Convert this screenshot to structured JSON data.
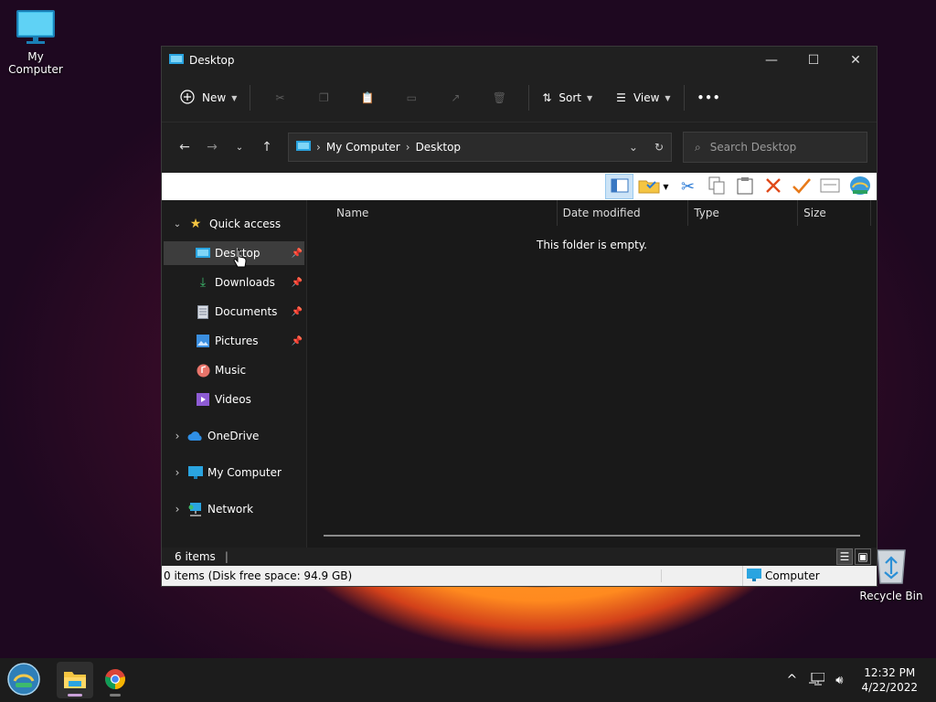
{
  "desktop": {
    "my_computer_label": "My Computer",
    "recycle_bin_label": "Recycle Bin"
  },
  "window": {
    "title": "Desktop",
    "controls": {
      "minimize": "—",
      "maximize": "☐",
      "close": "✕"
    }
  },
  "commandbar": {
    "new_label": "New",
    "sort_label": "Sort",
    "view_label": "View",
    "more_label": "•••"
  },
  "address": {
    "crumbs": [
      "My Computer",
      "Desktop"
    ],
    "search_placeholder": "Search Desktop"
  },
  "nav": {
    "quick_access": "Quick access",
    "items": [
      {
        "label": "Desktop",
        "pinned": true,
        "selected": true
      },
      {
        "label": "Downloads",
        "pinned": true
      },
      {
        "label": "Documents",
        "pinned": true
      },
      {
        "label": "Pictures",
        "pinned": true
      },
      {
        "label": "Music",
        "pinned": false
      },
      {
        "label": "Videos",
        "pinned": false
      }
    ],
    "roots": [
      "OneDrive",
      "My Computer",
      "Network"
    ]
  },
  "columns": [
    "Name",
    "Date modified",
    "Type",
    "Size"
  ],
  "empty_message": "This folder is empty.",
  "status": {
    "item_count": "6 items",
    "classic_left": "0 items (Disk free space: 94.9 GB)",
    "classic_right": "Computer"
  },
  "taskbar": {
    "time": "12:32 PM",
    "date": "4/22/2022",
    "tray_chevron": "^"
  },
  "colors": {
    "window_bg": "#202020",
    "nav_selected": "#3d3d3d",
    "accent_folder": "#f5c542",
    "accent_blue": "#2aa4e0",
    "close_x_red": "#e04a1a",
    "check_orange": "#e87a1a"
  }
}
